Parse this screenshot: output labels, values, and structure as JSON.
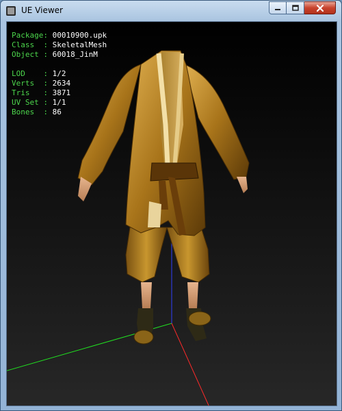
{
  "window": {
    "title": "UE Viewer",
    "controls": [
      "minimize",
      "maximize",
      "close"
    ],
    "icons": {
      "app": "ue-viewer-app-icon",
      "minimize": "minimize-icon",
      "maximize": "maximize-icon",
      "close": "close-icon"
    }
  },
  "info": {
    "package_label": "Package",
    "package_value": "00010900.upk",
    "class_label": "Class",
    "class_value": "SkeletalMesh",
    "object_label": "Object",
    "object_value": "60018_JinM",
    "lod_label": "LOD",
    "lod_value": "1/2",
    "verts_label": "Verts",
    "verts_value": "2634",
    "tris_label": "Tris",
    "tris_value": "3871",
    "uvset_label": "UV Set",
    "uvset_value": "1/1",
    "bones_label": "Bones",
    "bones_value": "86"
  },
  "colors": {
    "label_green": "#4cd64c",
    "value_white": "#ffffff",
    "axis_x": "#ff2a2a",
    "axis_y": "#20e020",
    "axis_z": "#3040ff",
    "robe_gold": "#b8860b"
  }
}
